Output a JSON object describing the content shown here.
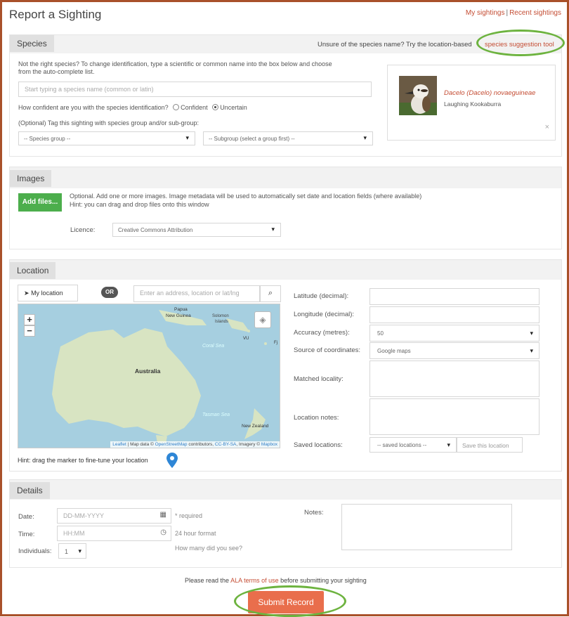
{
  "header": {
    "title": "Report a Sighting",
    "my_sightings": "My sightings",
    "separator": "|",
    "recent_sightings": "Recent sightings"
  },
  "species": {
    "tab": "Species",
    "unsure_text": "Unsure of the species name? Try the location-based",
    "suggestion_link": "species suggestion tool",
    "hint_line1": "Not the right species? To change identification, type a scientific or common name into the box below and choose",
    "hint_line2": "from the auto-complete list.",
    "search_placeholder": "Start typing a species name (common or latin)",
    "confidence_question": "How confident are you with the species identification?",
    "confident_label": "Confident",
    "uncertain_label": "Uncertain",
    "confidence_selected": "Uncertain",
    "tag_text": "(Optional) Tag this sighting with species group and/or sub-group:",
    "group_select": "-- Species group --",
    "subgroup_select": "-- Subgroup (select a group first) --",
    "card_sci_name": "Dacelo (Dacelo) novaeguineae",
    "card_common_name": "Laughing Kookaburra",
    "card_close": "×"
  },
  "images": {
    "tab": "Images",
    "add_files": "Add files...",
    "info_line1": "Optional. Add one or more images. Image metadata will be used to automatically set date and location fields (where available)",
    "info_line2": "Hint: you can drag and drop files onto this window",
    "licence_label": "Licence:",
    "licence_value": "Creative Commons Attribution"
  },
  "location": {
    "tab": "Location",
    "my_location": "My location",
    "or": "OR",
    "address_placeholder": "Enter an address, location or lat/lng",
    "map_labels": {
      "papua": "Papua",
      "new_guinea": "New Guinea",
      "solomon": "Solomon",
      "islands": "Islands",
      "coral_sea": "Coral Sea",
      "vu": "VU",
      "fj": "Fj",
      "australia": "Australia",
      "tasman_sea": "Tasman Sea",
      "new_zealand": "New Zealand"
    },
    "attribution": {
      "leaflet": "Leaflet",
      "map_data": "| Map data ©",
      "osm": "OpenStreetMap",
      "contributors": "contributors,",
      "ccbysa": "CC-BY-SA",
      "imagery": ", Imagery ©",
      "mapbox": "Mapbox"
    },
    "hint": "Hint: drag the marker to fine-tune your location",
    "latitude_label": "Latitude (decimal):",
    "longitude_label": "Longitude (decimal):",
    "accuracy_label": "Accuracy (metres):",
    "accuracy_value": "50",
    "source_label": "Source of coordinates:",
    "source_value": "Google maps",
    "matched_label": "Matched locality:",
    "notes_label": "Location notes:",
    "saved_label": "Saved locations:",
    "saved_select": "-- saved locations --",
    "save_button": "Save this location"
  },
  "details": {
    "tab": "Details",
    "date_label": "Date:",
    "date_placeholder": "DD-MM-YYYY",
    "required": "* required",
    "time_label": "Time:",
    "time_placeholder": "HH:MM",
    "time_format": "24 hour format",
    "individuals_label": "Individuals:",
    "individuals_value": "1",
    "how_many": "How many did you see?",
    "notes_label": "Notes:"
  },
  "footer": {
    "terms_before": "Please read the",
    "terms_link": "ALA terms of use",
    "terms_after": "before submitting your sighting",
    "submit": "Submit Record"
  }
}
